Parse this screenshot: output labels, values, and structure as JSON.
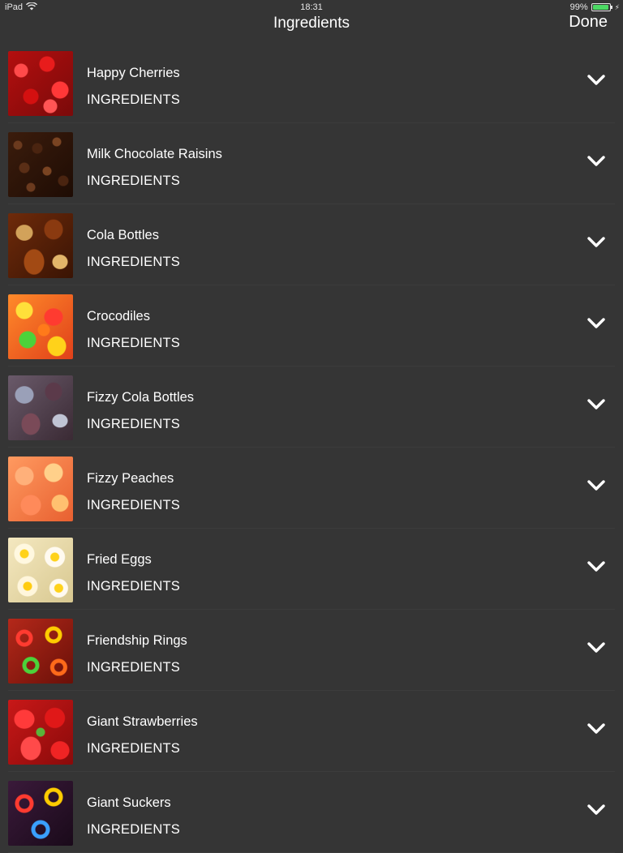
{
  "status_bar": {
    "device": "iPad",
    "time": "18:31",
    "battery": "99%",
    "battery_level": 0.99
  },
  "nav": {
    "title": "Ingredients",
    "done_label": "Done"
  },
  "items": [
    {
      "title": "Happy Cherries",
      "subtitle": "INGREDIENTS",
      "thumb": "t-cherries"
    },
    {
      "title": "Milk Chocolate Raisins",
      "subtitle": "INGREDIENTS",
      "thumb": "t-choc"
    },
    {
      "title": "Cola Bottles",
      "subtitle": "INGREDIENTS",
      "thumb": "t-cola"
    },
    {
      "title": "Crocodiles",
      "subtitle": "INGREDIENTS",
      "thumb": "t-croc"
    },
    {
      "title": "Fizzy Cola Bottles",
      "subtitle": "INGREDIENTS",
      "thumb": "t-fizzy"
    },
    {
      "title": "Fizzy Peaches",
      "subtitle": "INGREDIENTS",
      "thumb": "t-peach"
    },
    {
      "title": "Fried Eggs",
      "subtitle": "INGREDIENTS",
      "thumb": "t-eggs"
    },
    {
      "title": "Friendship Rings",
      "subtitle": "INGREDIENTS",
      "thumb": "t-rings"
    },
    {
      "title": "Giant Strawberries",
      "subtitle": "INGREDIENTS",
      "thumb": "t-straw"
    },
    {
      "title": "Giant Suckers",
      "subtitle": "INGREDIENTS",
      "thumb": "t-suckers"
    }
  ],
  "icons": {
    "expand": "chevron-down-icon",
    "wifi": "wifi-icon",
    "battery": "battery-icon"
  },
  "colors": {
    "background": "#353535",
    "text": "#ffffff",
    "separator": "#3c3c3c",
    "battery_fill": "#4cd964"
  }
}
